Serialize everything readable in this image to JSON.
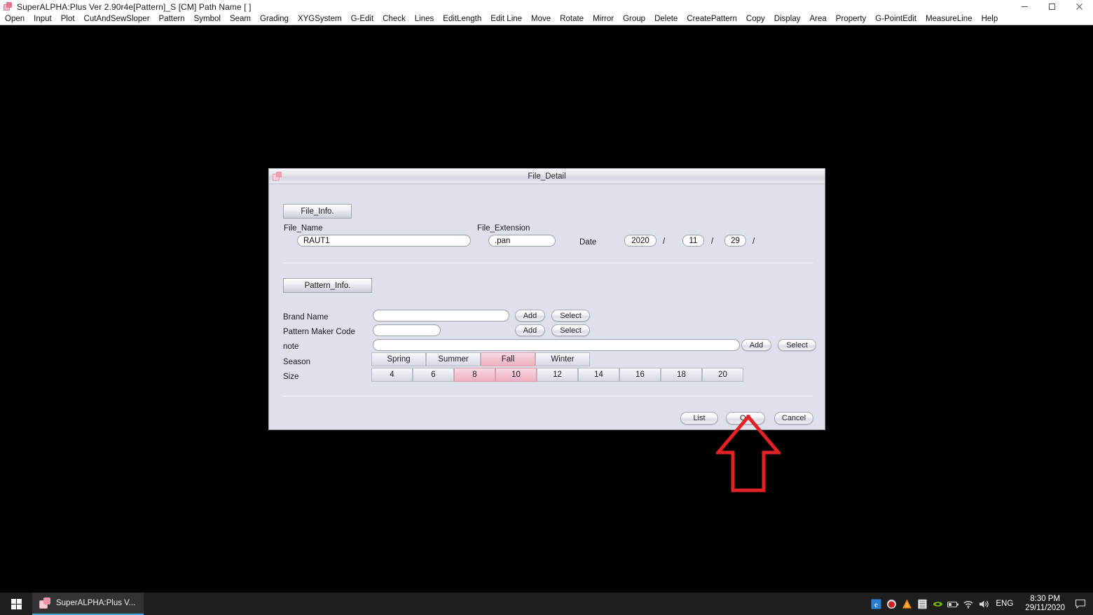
{
  "window": {
    "title": "SuperALPHA:Plus Ver 2.90r4e[Pattern]_S [CM]  Path Name  [ ]",
    "icon": "app-icon",
    "controls": [
      {
        "name": "minimize-button",
        "glyph": "minimize-icon"
      },
      {
        "name": "maximize-button",
        "glyph": "maximize-icon"
      },
      {
        "name": "close-button",
        "glyph": "close-icon"
      }
    ]
  },
  "menubar": {
    "items": [
      "Open",
      "Input",
      "Plot",
      "CutAndSewSloper",
      "Pattern",
      "Symbol",
      "Seam",
      "Grading",
      "XYGSystem",
      "G-Edit",
      "Check",
      "Lines",
      "EditLength",
      "Edit Line",
      "Move",
      "Rotate",
      "Mirror",
      "Group",
      "Delete",
      "CreatePattern",
      "Copy",
      "Display",
      "Area",
      "Property",
      "G-PointEdit",
      "MeasureLine",
      "Help"
    ]
  },
  "dialog": {
    "title": "File_Detail",
    "file_info": {
      "group_label": "File_Info.",
      "file_name_label": "File_Name",
      "file_name_value": "RAUT1",
      "file_extension_label": "File_Extension",
      "file_extension_value": ".pan",
      "date_label": "Date",
      "date_year": "2020",
      "date_month": "11",
      "date_day": "29",
      "separator": "/"
    },
    "pattern_info": {
      "group_label": "Pattern_Info.",
      "brand_name_label": "Brand Name",
      "brand_name_value": "",
      "brand_add_label": "Add",
      "brand_select_label": "Select",
      "maker_code_label": "Pattern Maker Code",
      "maker_code_value": "",
      "maker_add_label": "Add",
      "maker_select_label": "Select",
      "note_label": "note",
      "note_value": "",
      "note_add_label": "Add",
      "note_select_label": "Select",
      "season_label": "Season",
      "seasons": [
        {
          "label": "Spring",
          "selected": false
        },
        {
          "label": "Summer",
          "selected": false
        },
        {
          "label": "Fall",
          "selected": true
        },
        {
          "label": "Winter",
          "selected": false
        }
      ],
      "size_label": "Size",
      "sizes": [
        {
          "label": "4",
          "selected": false
        },
        {
          "label": "6",
          "selected": false
        },
        {
          "label": "8",
          "selected": true
        },
        {
          "label": "10",
          "selected": true
        },
        {
          "label": "12",
          "selected": false
        },
        {
          "label": "14",
          "selected": false
        },
        {
          "label": "16",
          "selected": false
        },
        {
          "label": "18",
          "selected": false
        },
        {
          "label": "20",
          "selected": false
        }
      ]
    },
    "actions": {
      "list_label": "List",
      "ok_label": "OK",
      "cancel_label": "Cancel"
    }
  },
  "annotation": {
    "shape": "up-arrow",
    "color": "#e32227",
    "points_at": "OK"
  },
  "taskbar": {
    "start_name": "start-button",
    "task_label": "SuperALPHA:Plus V...",
    "tray_icons": [
      "internet-explorer-icon",
      "screen-recorder-icon",
      "avast-icon",
      "file-manager-icon",
      "nvidia-icon",
      "battery-icon",
      "wifi-icon",
      "volume-icon"
    ],
    "language": "ENG",
    "time": "8:30 PM",
    "date": "29/11/2020",
    "action_center": "action-center-icon"
  }
}
